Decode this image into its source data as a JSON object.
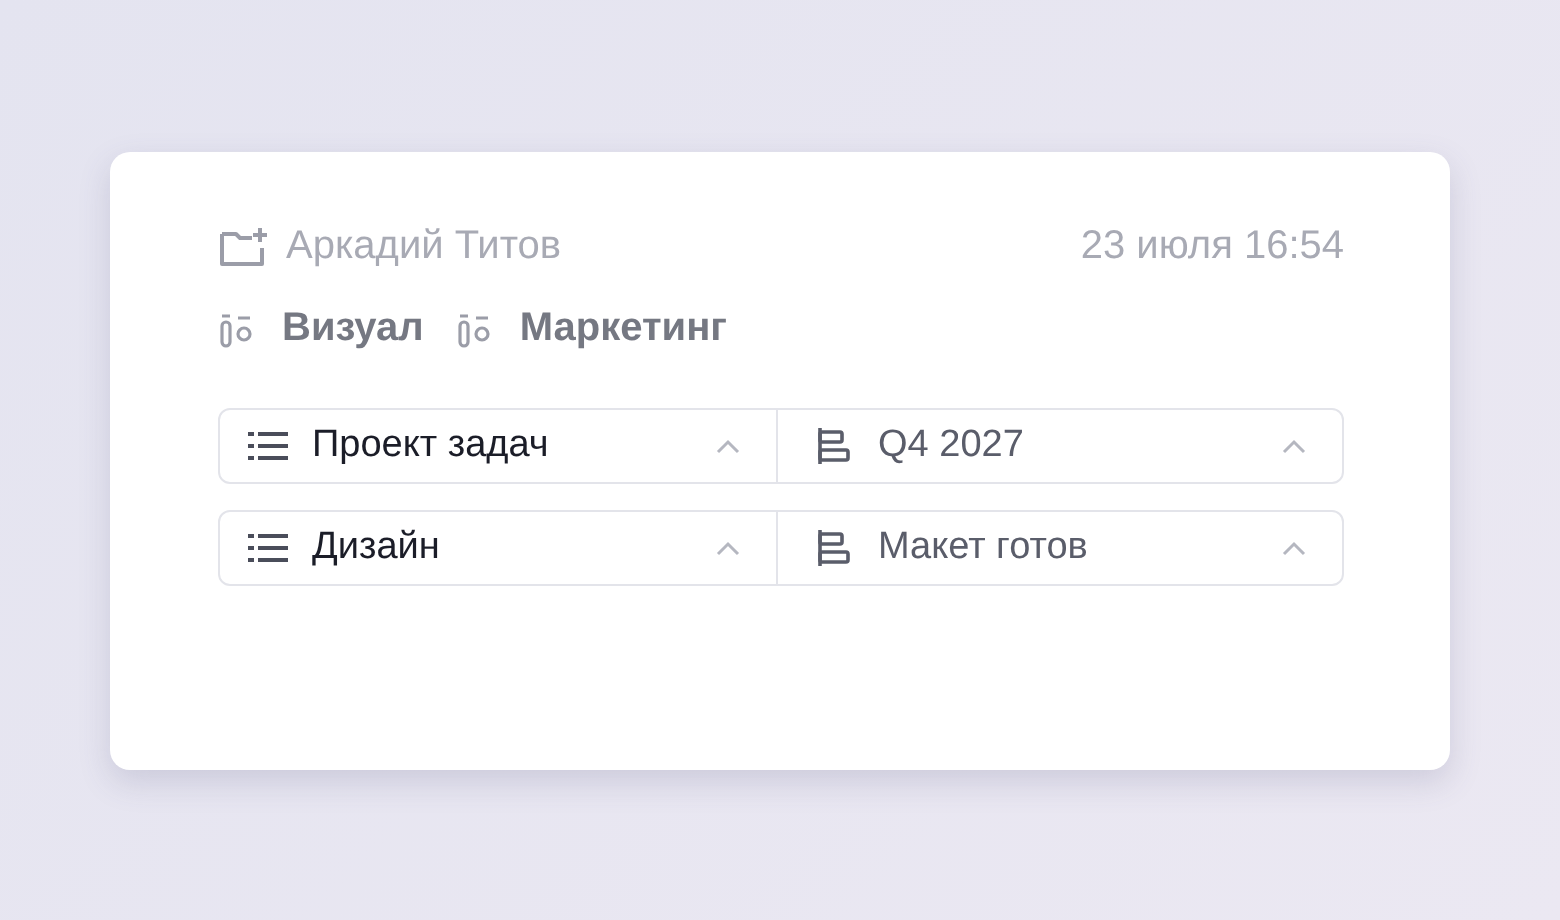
{
  "author": "Аркадий Титов",
  "timestamp": "23 июля 16:54",
  "tags": [
    {
      "label": "Визуал"
    },
    {
      "label": "Маркетинг"
    }
  ],
  "rows": [
    {
      "field": "Проект задач",
      "value": "Q4 2027"
    },
    {
      "field": "Дизайн",
      "value": "Макет готов"
    }
  ]
}
